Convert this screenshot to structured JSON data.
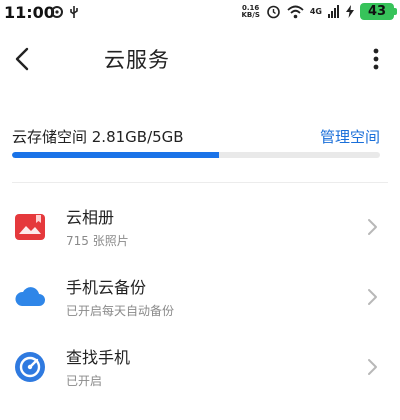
{
  "status_bar": {
    "time": "11:00",
    "net_speed_value": "0.16",
    "net_speed_unit": "KB/S",
    "signal_label": "4G",
    "battery_level": "43"
  },
  "header": {
    "title": "云服务"
  },
  "storage": {
    "label": "云存储空间 2.81GB/5GB",
    "manage_label": "管理空间",
    "used_fraction": 0.562,
    "accent_color": "#1a73e8"
  },
  "services": [
    {
      "title": "云相册",
      "subtitle": "715 张照片",
      "icon": "photo-album-icon",
      "icon_color": "#e5393c"
    },
    {
      "title": "手机云备份",
      "subtitle": "已开启每天自动备份",
      "icon": "cloud-icon",
      "icon_color": "#2f86e8"
    },
    {
      "title": "查找手机",
      "subtitle": "已开启",
      "icon": "find-phone-icon",
      "icon_color": "#2f7ae0"
    }
  ]
}
